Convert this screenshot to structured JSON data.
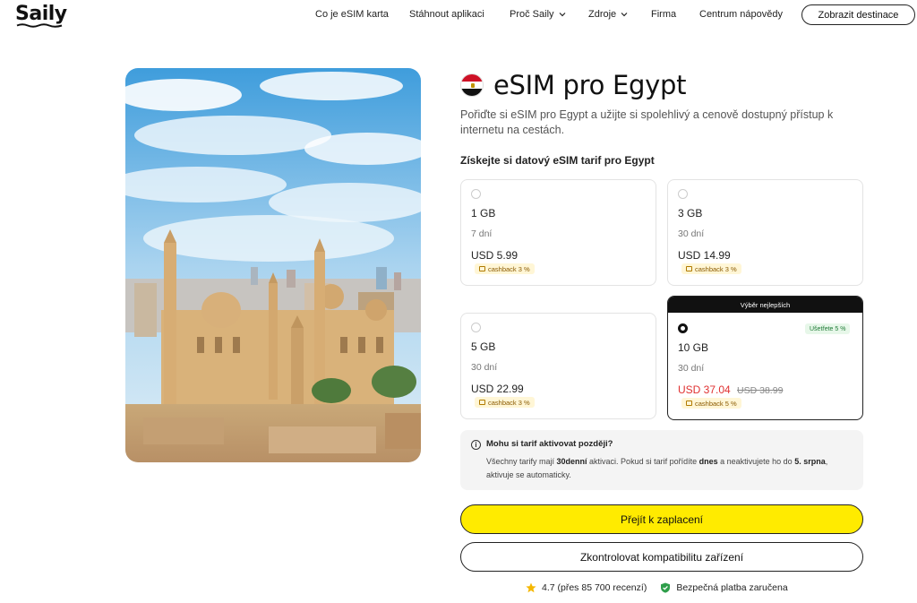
{
  "brand": {
    "logo": "Saily"
  },
  "nav": {
    "items": [
      {
        "label": "Co je eSIM karta"
      },
      {
        "label": "Stáhnout aplikaci"
      },
      {
        "label": "Proč Saily"
      },
      {
        "label": "Zdroje"
      },
      {
        "label": "Firma"
      },
      {
        "label": "Centrum nápovědy"
      }
    ],
    "cta": "Zobrazit destinace"
  },
  "product": {
    "title": "eSIM pro Egypt",
    "description": "Pořiďte si eSIM pro Egypt a užijte si spolehlivý a cenově dostupný přístup k internetu na cestách.",
    "plans_heading": "Získejte si datový eSIM tarif pro Egypt"
  },
  "plans": [
    {
      "data": "1 GB",
      "duration": "7 dní",
      "price": "USD 5.99",
      "cashback": "cashback 3 %"
    },
    {
      "data": "3 GB",
      "duration": "30 dní",
      "price": "USD 14.99",
      "cashback": "cashback 3 %"
    },
    {
      "data": "5 GB",
      "duration": "30 dní",
      "price": "USD 22.99",
      "cashback": "cashback 3 %"
    },
    {
      "data": "10 GB",
      "duration": "30 dní",
      "price": "USD 37.04",
      "old_price": "USD 38.99",
      "cashback": "cashback 5 %",
      "badge": "Výběr nejlepších",
      "saving": "Ušetřete 5 %",
      "selected": true
    }
  ],
  "info": {
    "question": "Mohu si tarif aktivovat později?",
    "answer_1": "Všechny tarify mají ",
    "answer_bold_1": "30denní",
    "answer_2": " aktivaci. Pokud si tarif pořídíte ",
    "answer_bold_2": "dnes",
    "answer_3": " a neaktivujete ho do ",
    "answer_bold_3": "5. srpna",
    "answer_4": ", aktivuje se automaticky."
  },
  "actions": {
    "checkout": "Přejít k zaplacení",
    "compatibility": "Zkontrolovat kompatibilitu zařízení"
  },
  "trust": {
    "rating": "4.7 (přes 85 700 recenzí)",
    "secure": "Bezpečná platba zaručena"
  },
  "icons": {
    "rating": "star-icon",
    "secure": "shield-check-icon",
    "info": "info-icon",
    "dropdown": "chevron-down-icon"
  },
  "colors": {
    "primary_button": "#ffeb00",
    "sale_price": "#e03131",
    "saving_badge": "#1e7a35",
    "cashback_bg": "#fff6d6"
  }
}
